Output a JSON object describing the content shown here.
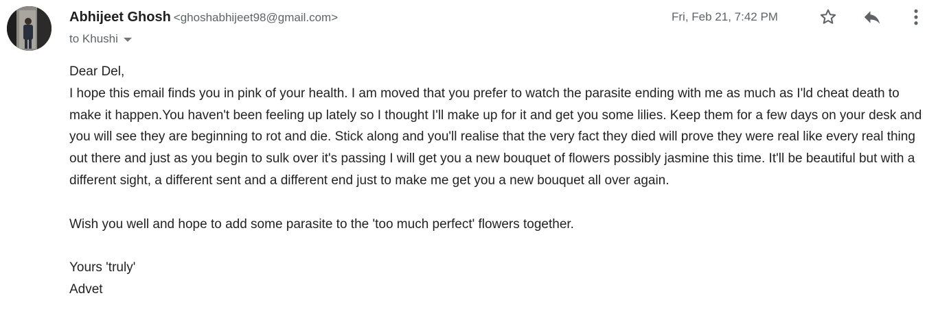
{
  "sender": {
    "name": "Abhijeet Ghosh",
    "email": "<ghoshabhijeet98@gmail.com>"
  },
  "recipient": {
    "label": "to Khushi"
  },
  "timestamp": "Fri, Feb 21, 7:42 PM",
  "actions": {
    "star_icon": "star-outline-icon",
    "reply_icon": "reply-arrow-icon",
    "more_icon": "vertical-dots-icon"
  },
  "body": {
    "greeting": "Dear Del,",
    "paragraph1": "I hope this email finds you in pink of your health. I am moved that you prefer to watch the parasite ending with me as much as I'ld cheat death to make it happen.You haven't been feeling up lately so I thought I'll make up for it and get you some lilies. Keep them for a few days on your desk and you will see they are beginning to rot and die. Stick along and you'll realise that the very fact they died will prove they were real like every real thing out there and just as you begin to sulk over it's passing I will get you a new bouquet of flowers possibly jasmine this time. It'll be beautiful but with a different sight, a different sent and a different end just to make me get you a new bouquet all over again.",
    "paragraph2": "Wish you well and hope to add some parasite to the 'too much perfect' flowers together.",
    "closing": "Yours 'truly'",
    "signature": "Advet"
  },
  "colors": {
    "text": "#222222",
    "secondary_text": "#5f6368",
    "icon": "#5f6368"
  }
}
